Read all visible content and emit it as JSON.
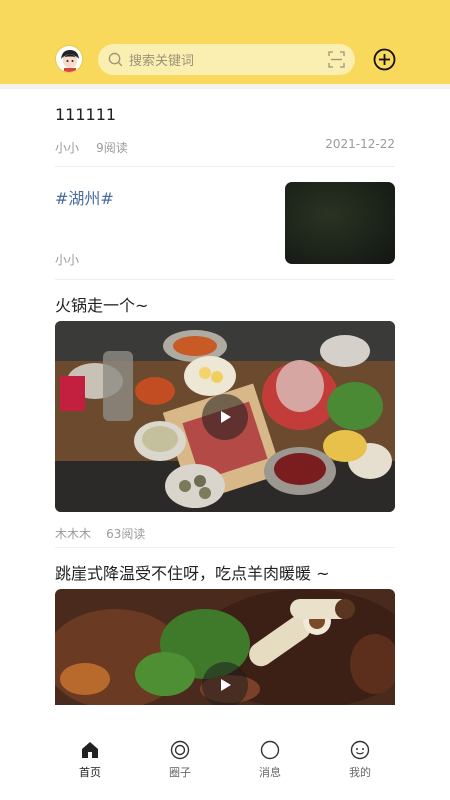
{
  "header": {
    "search_placeholder": "搜索关键词"
  },
  "feed": [
    {
      "title": "111111",
      "author": "小小",
      "reads": "9阅读",
      "date": "2021-12-22"
    },
    {
      "title": "#湖州#",
      "author": "小小"
    },
    {
      "title": "火锅走一个~",
      "author": "木木木",
      "reads": "63阅读"
    },
    {
      "title": "跳崖式降温受不住呀，吃点羊肉暖暖 ~"
    }
  ],
  "tabs": [
    {
      "label": "首页",
      "icon": "home-icon",
      "active": true
    },
    {
      "label": "圈子",
      "icon": "circle-icon"
    },
    {
      "label": "消息",
      "icon": "message-icon"
    },
    {
      "label": "我的",
      "icon": "profile-icon"
    }
  ],
  "colors": {
    "header_bg": "#f8d95b",
    "tag_text": "#4a6c9c"
  }
}
